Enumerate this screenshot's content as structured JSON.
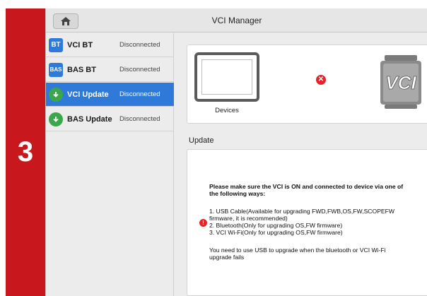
{
  "step": {
    "number": "3"
  },
  "window": {
    "title": "VCI Manager"
  },
  "sidebar": {
    "items": [
      {
        "icon_text": "BT",
        "label": "VCI BT",
        "status": "Disconnected"
      },
      {
        "icon_text": "BAS",
        "label": "BAS BT",
        "status": "Disconnected"
      },
      {
        "icon_name": "download-icon",
        "label": "VCI Update",
        "status": "Disconnected"
      },
      {
        "icon_name": "download-icon",
        "label": "BAS Update",
        "status": "Disconnected"
      }
    ]
  },
  "devices": {
    "label": "Devices",
    "connection_icon": "error-x-icon",
    "vci_logo": "VCI"
  },
  "update": {
    "header": "Update",
    "lines": {
      "l1": "Please make sure the VCI is ON and connected to device via one of",
      "l2": "the following ways:",
      "l3": "1. USB Cable(Available for upgrading FWD,FWB,OS,FW,SCOPEFW",
      "l4": "firmware, it is recommended)",
      "l5": "2. Bluetooth(Only for upgrading OS,FW firmware)",
      "l6": "3. VCI Wi-Fi(Only for upgrading OS,FW firmware)",
      "l7": "You need to use USB to upgrade when the bluetooth or VCI Wi-Fi",
      "l8": "upgrade fails"
    }
  },
  "colors": {
    "accent": "#2f7ad8",
    "step_bar": "#c8181e",
    "error": "#e2242b",
    "update_green": "#3aa84a"
  }
}
